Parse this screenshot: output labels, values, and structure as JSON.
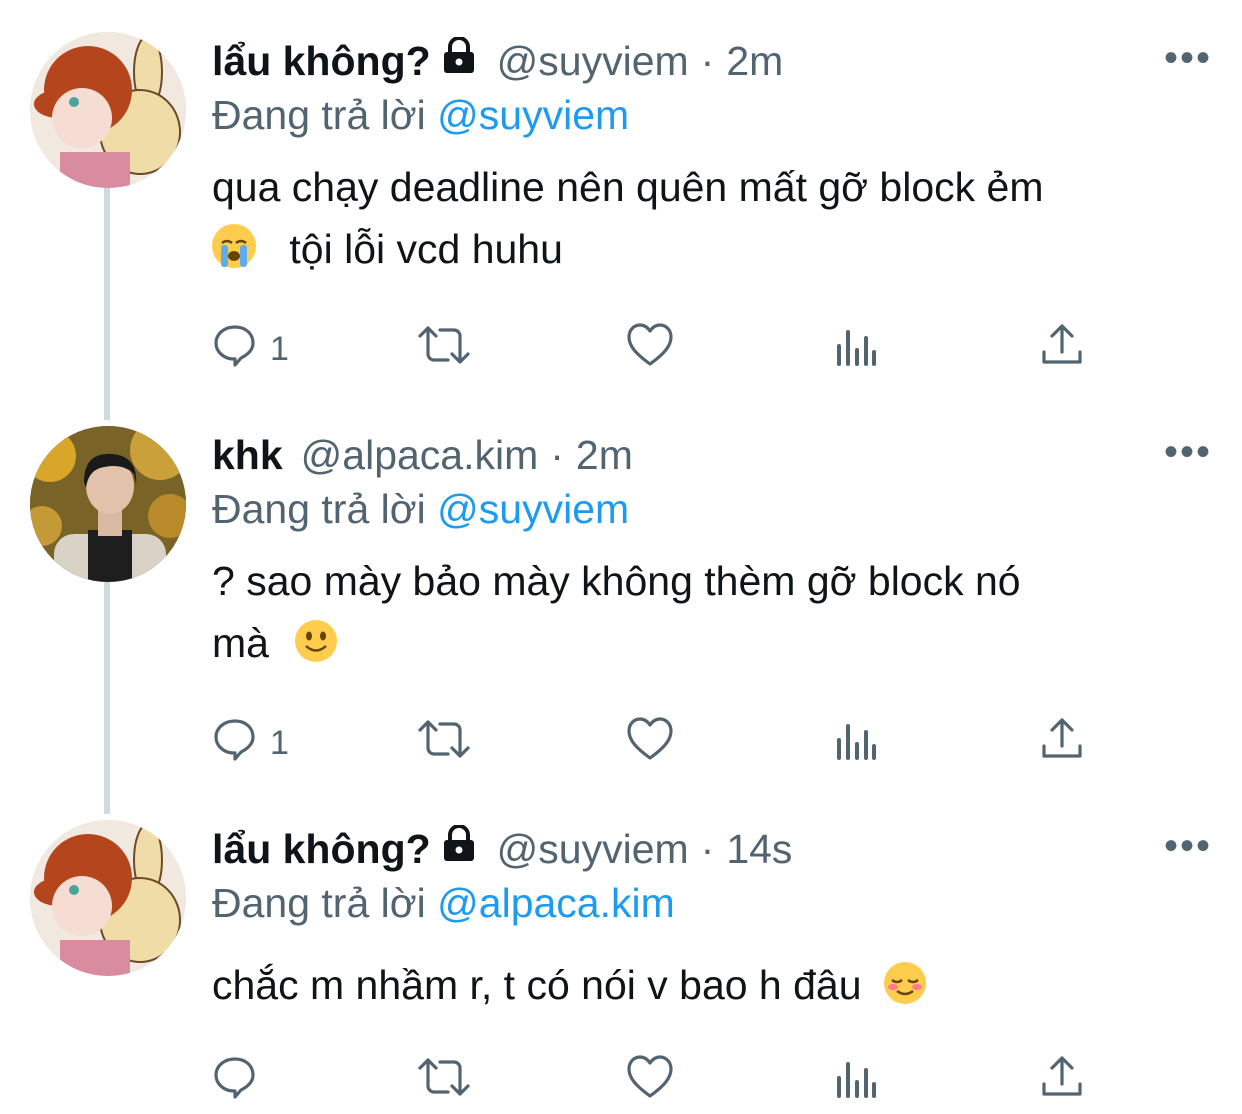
{
  "tweets": [
    {
      "name": "lẩu không?",
      "handle": "@suyviem",
      "dot": "·",
      "time": "2m",
      "reply_prefix": "Đang trả lời",
      "reply_to": "@suyviem",
      "text_line1": "qua chạy deadline nên quên mất gỡ block ẻm",
      "text_line2": "tội lỗi vcd huhu",
      "reply_count": "1",
      "more": "•••"
    },
    {
      "name": "khk",
      "handle": "@alpaca.kim",
      "dot": "·",
      "time": "2m",
      "reply_prefix": "Đang trả lời",
      "reply_to": "@suyviem",
      "text_line1": "? sao mày bảo mày không thèm gỡ block nó",
      "text_line2": "mà",
      "reply_count": "1",
      "more": "•••"
    },
    {
      "name": "lẩu không?",
      "handle": "@suyviem",
      "dot": "·",
      "time": "14s",
      "reply_prefix": "Đang trả lời",
      "reply_to": "@alpaca.kim",
      "text_line1": "chắc m nhầm r, t có nói v bao h đâu",
      "reply_count": "",
      "more": "•••"
    }
  ],
  "icons": {
    "reply": "reply-icon",
    "retweet": "retweet-icon",
    "like": "heart-icon",
    "views": "views-icon",
    "share": "share-icon",
    "lock": "lock-icon"
  },
  "colors": {
    "mention": "#1d9bf0",
    "secondary_text": "#536471",
    "thread_line": "#cfd9de"
  }
}
